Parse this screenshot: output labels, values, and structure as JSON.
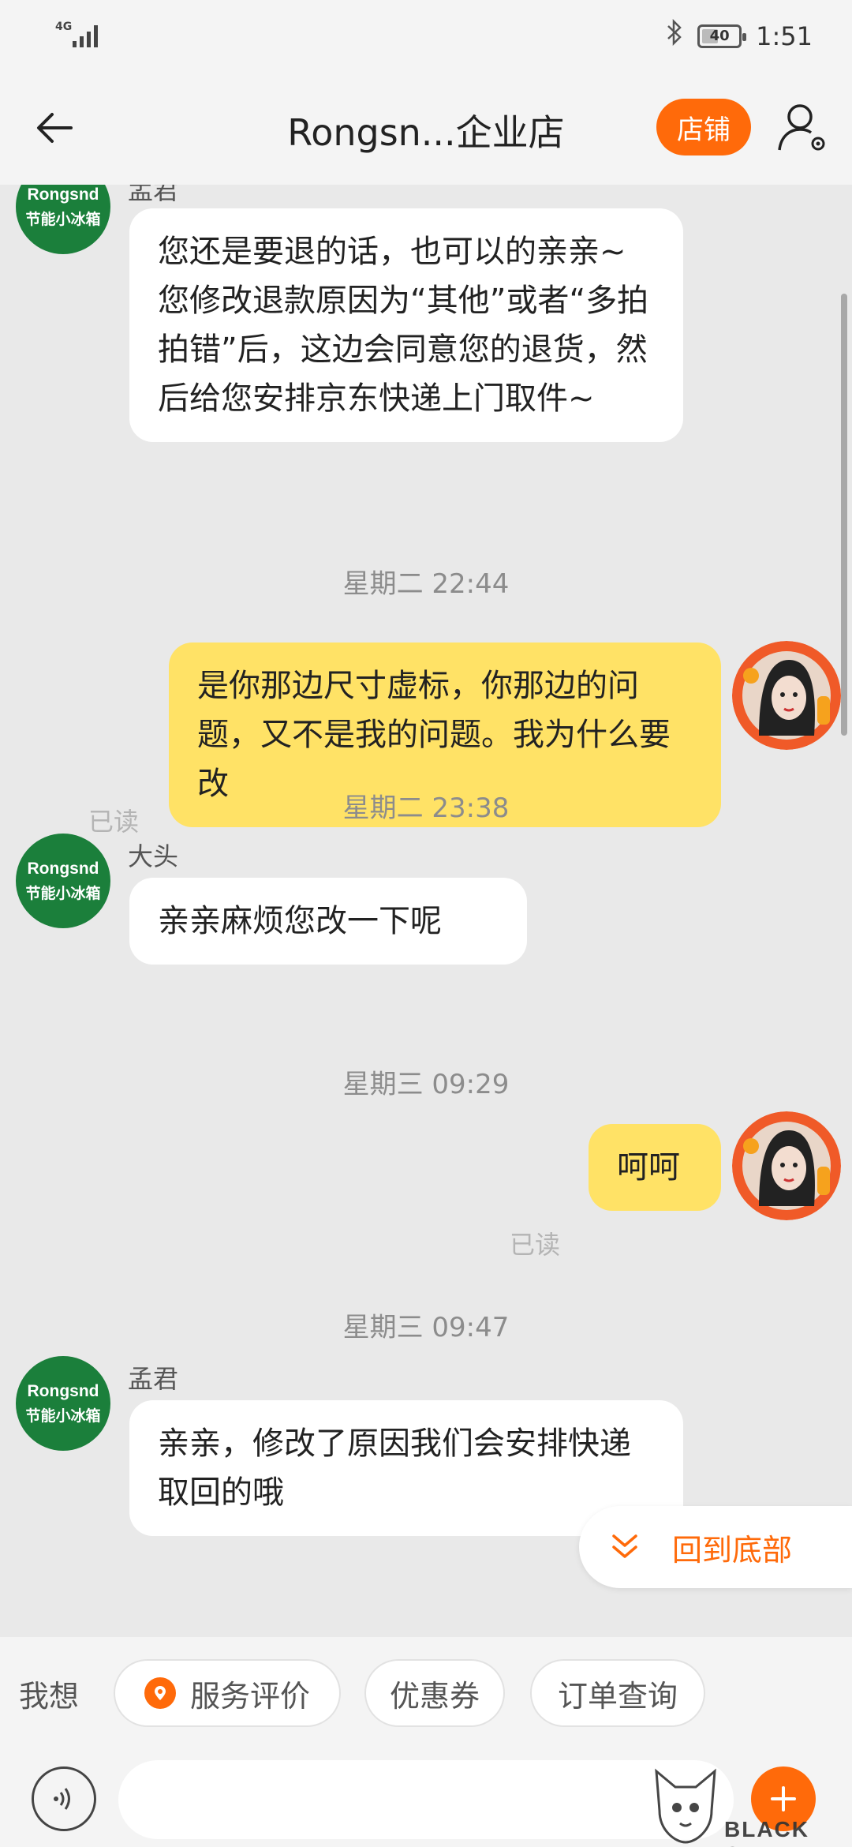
{
  "status_bar": {
    "network": "4G",
    "battery_level": "40",
    "time": "1:51"
  },
  "header": {
    "title": "Rongsn...企业店",
    "shop_button": "店铺",
    "icons": [
      "back-arrow-icon",
      "user-settings-icon"
    ]
  },
  "shop_avatar": {
    "line1": "Rongsnd",
    "line2": "节能小冰箱"
  },
  "messages": [
    {
      "type": "in",
      "sender": "孟君",
      "text": "您还是要退的话，也可以的亲亲~您修改退款原因为“其他”或者“多拍拍错”后，这边会同意您的退货，然后给您安排京东快递上门取件~"
    },
    {
      "type": "time",
      "text": "星期二 22:44"
    },
    {
      "type": "out",
      "text": "是你那边尺寸虚标，你那边的问题，又不是我的问题。我为什么要改",
      "status": "已读"
    },
    {
      "type": "time",
      "text": "星期二 23:38"
    },
    {
      "type": "in",
      "sender": "大头",
      "text": "亲亲麻烦您改一下呢"
    },
    {
      "type": "time",
      "text": "星期三 09:29"
    },
    {
      "type": "out",
      "text": "呵呵",
      "status": "已读"
    },
    {
      "type": "time",
      "text": "星期三 09:47"
    },
    {
      "type": "in",
      "sender": "孟君",
      "text": "亲亲，修改了原因我们会安排快递取回的哦"
    }
  ],
  "back_to_bottom": "回到底部",
  "quick_bar": {
    "label": "我想",
    "chips": [
      "服务评价",
      "优惠券",
      "订单查询"
    ]
  },
  "input": {
    "placeholder": ""
  },
  "watermark": "BLACK CAT",
  "colors": {
    "accent": "#ff6a0a",
    "outgoing_bubble": "#ffe266",
    "shop_avatar": "#1b7f3b"
  }
}
